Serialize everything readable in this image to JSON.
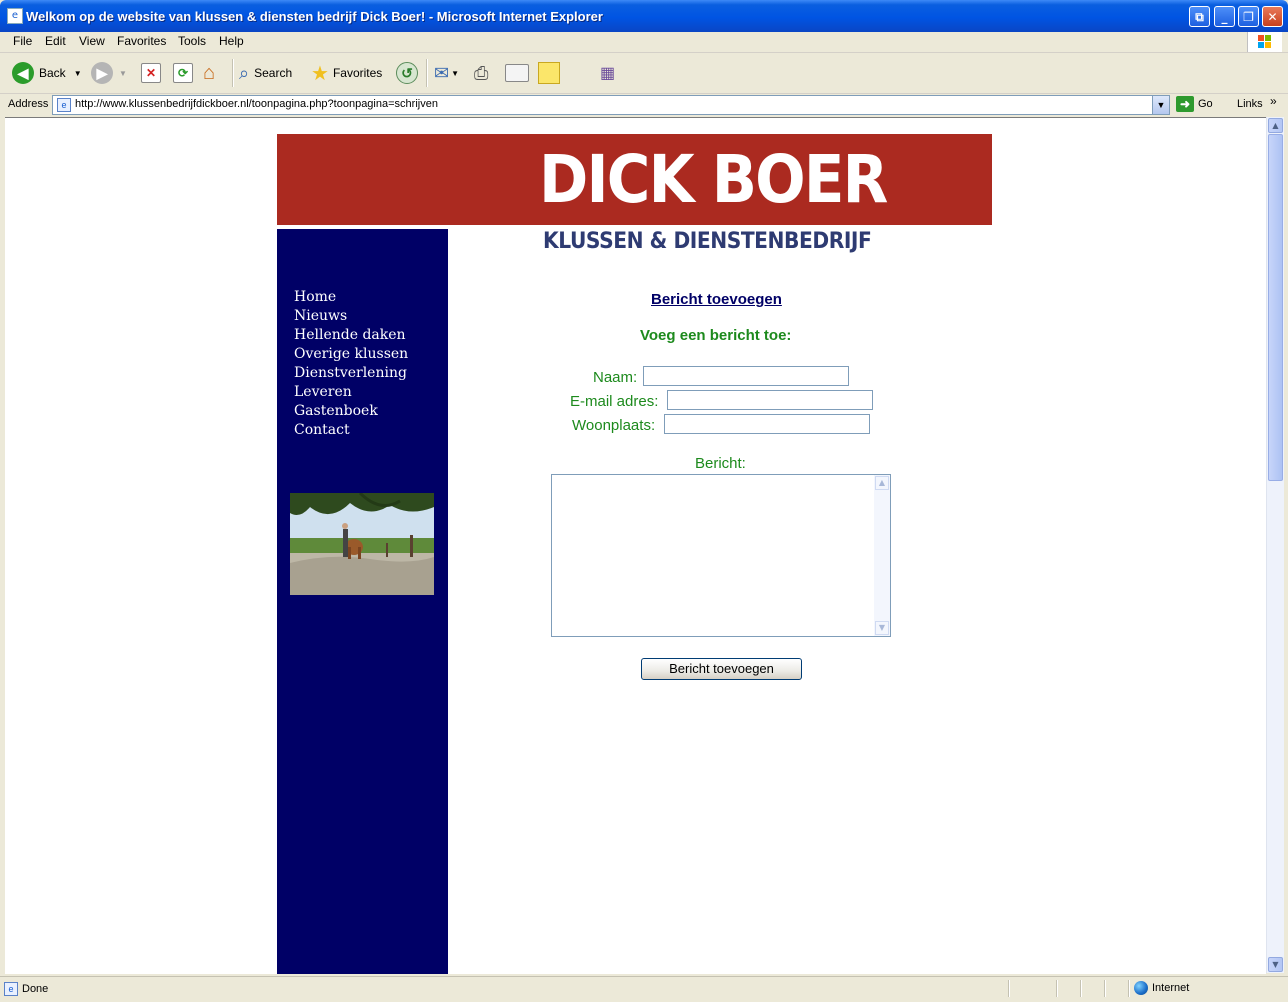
{
  "window": {
    "title": "Welkom op de website van klussen & diensten bedrijf Dick Boer! - Microsoft Internet Explorer"
  },
  "menu": {
    "items": [
      "File",
      "Edit",
      "View",
      "Favorites",
      "Tools",
      "Help"
    ]
  },
  "toolbar": {
    "back_label": "Back",
    "search_label": "Search",
    "favorites_label": "Favorites"
  },
  "address": {
    "label": "Address",
    "url": "http://www.klussenbedrijfdickboer.nl/toonpagina.php?toonpagina=schrijven",
    "go_label": "Go",
    "links_label": "Links"
  },
  "site": {
    "banner_title": "DICK BOER",
    "subtitle": "KLUSSEN & DIENSTENBEDRIJF",
    "nav": [
      "Home",
      "Nieuws",
      "Hellende daken",
      "Overige klussen",
      "Dienstverlening",
      "Leveren",
      "Gastenboek",
      "Contact"
    ]
  },
  "form": {
    "title": "Bericht toevoegen",
    "subtitle": "Voeg een bericht toe:",
    "name_label": "Naam:",
    "email_label": "E-mail adres:",
    "city_label": "Woonplaats:",
    "message_label": "Bericht:",
    "submit_label": "Bericht toevoegen"
  },
  "status": {
    "left": "Done",
    "zone": "Internet"
  },
  "colors": {
    "banner_red": "#ab2a20",
    "sidebar_navy": "#000066",
    "form_green": "#1d8a1d"
  }
}
